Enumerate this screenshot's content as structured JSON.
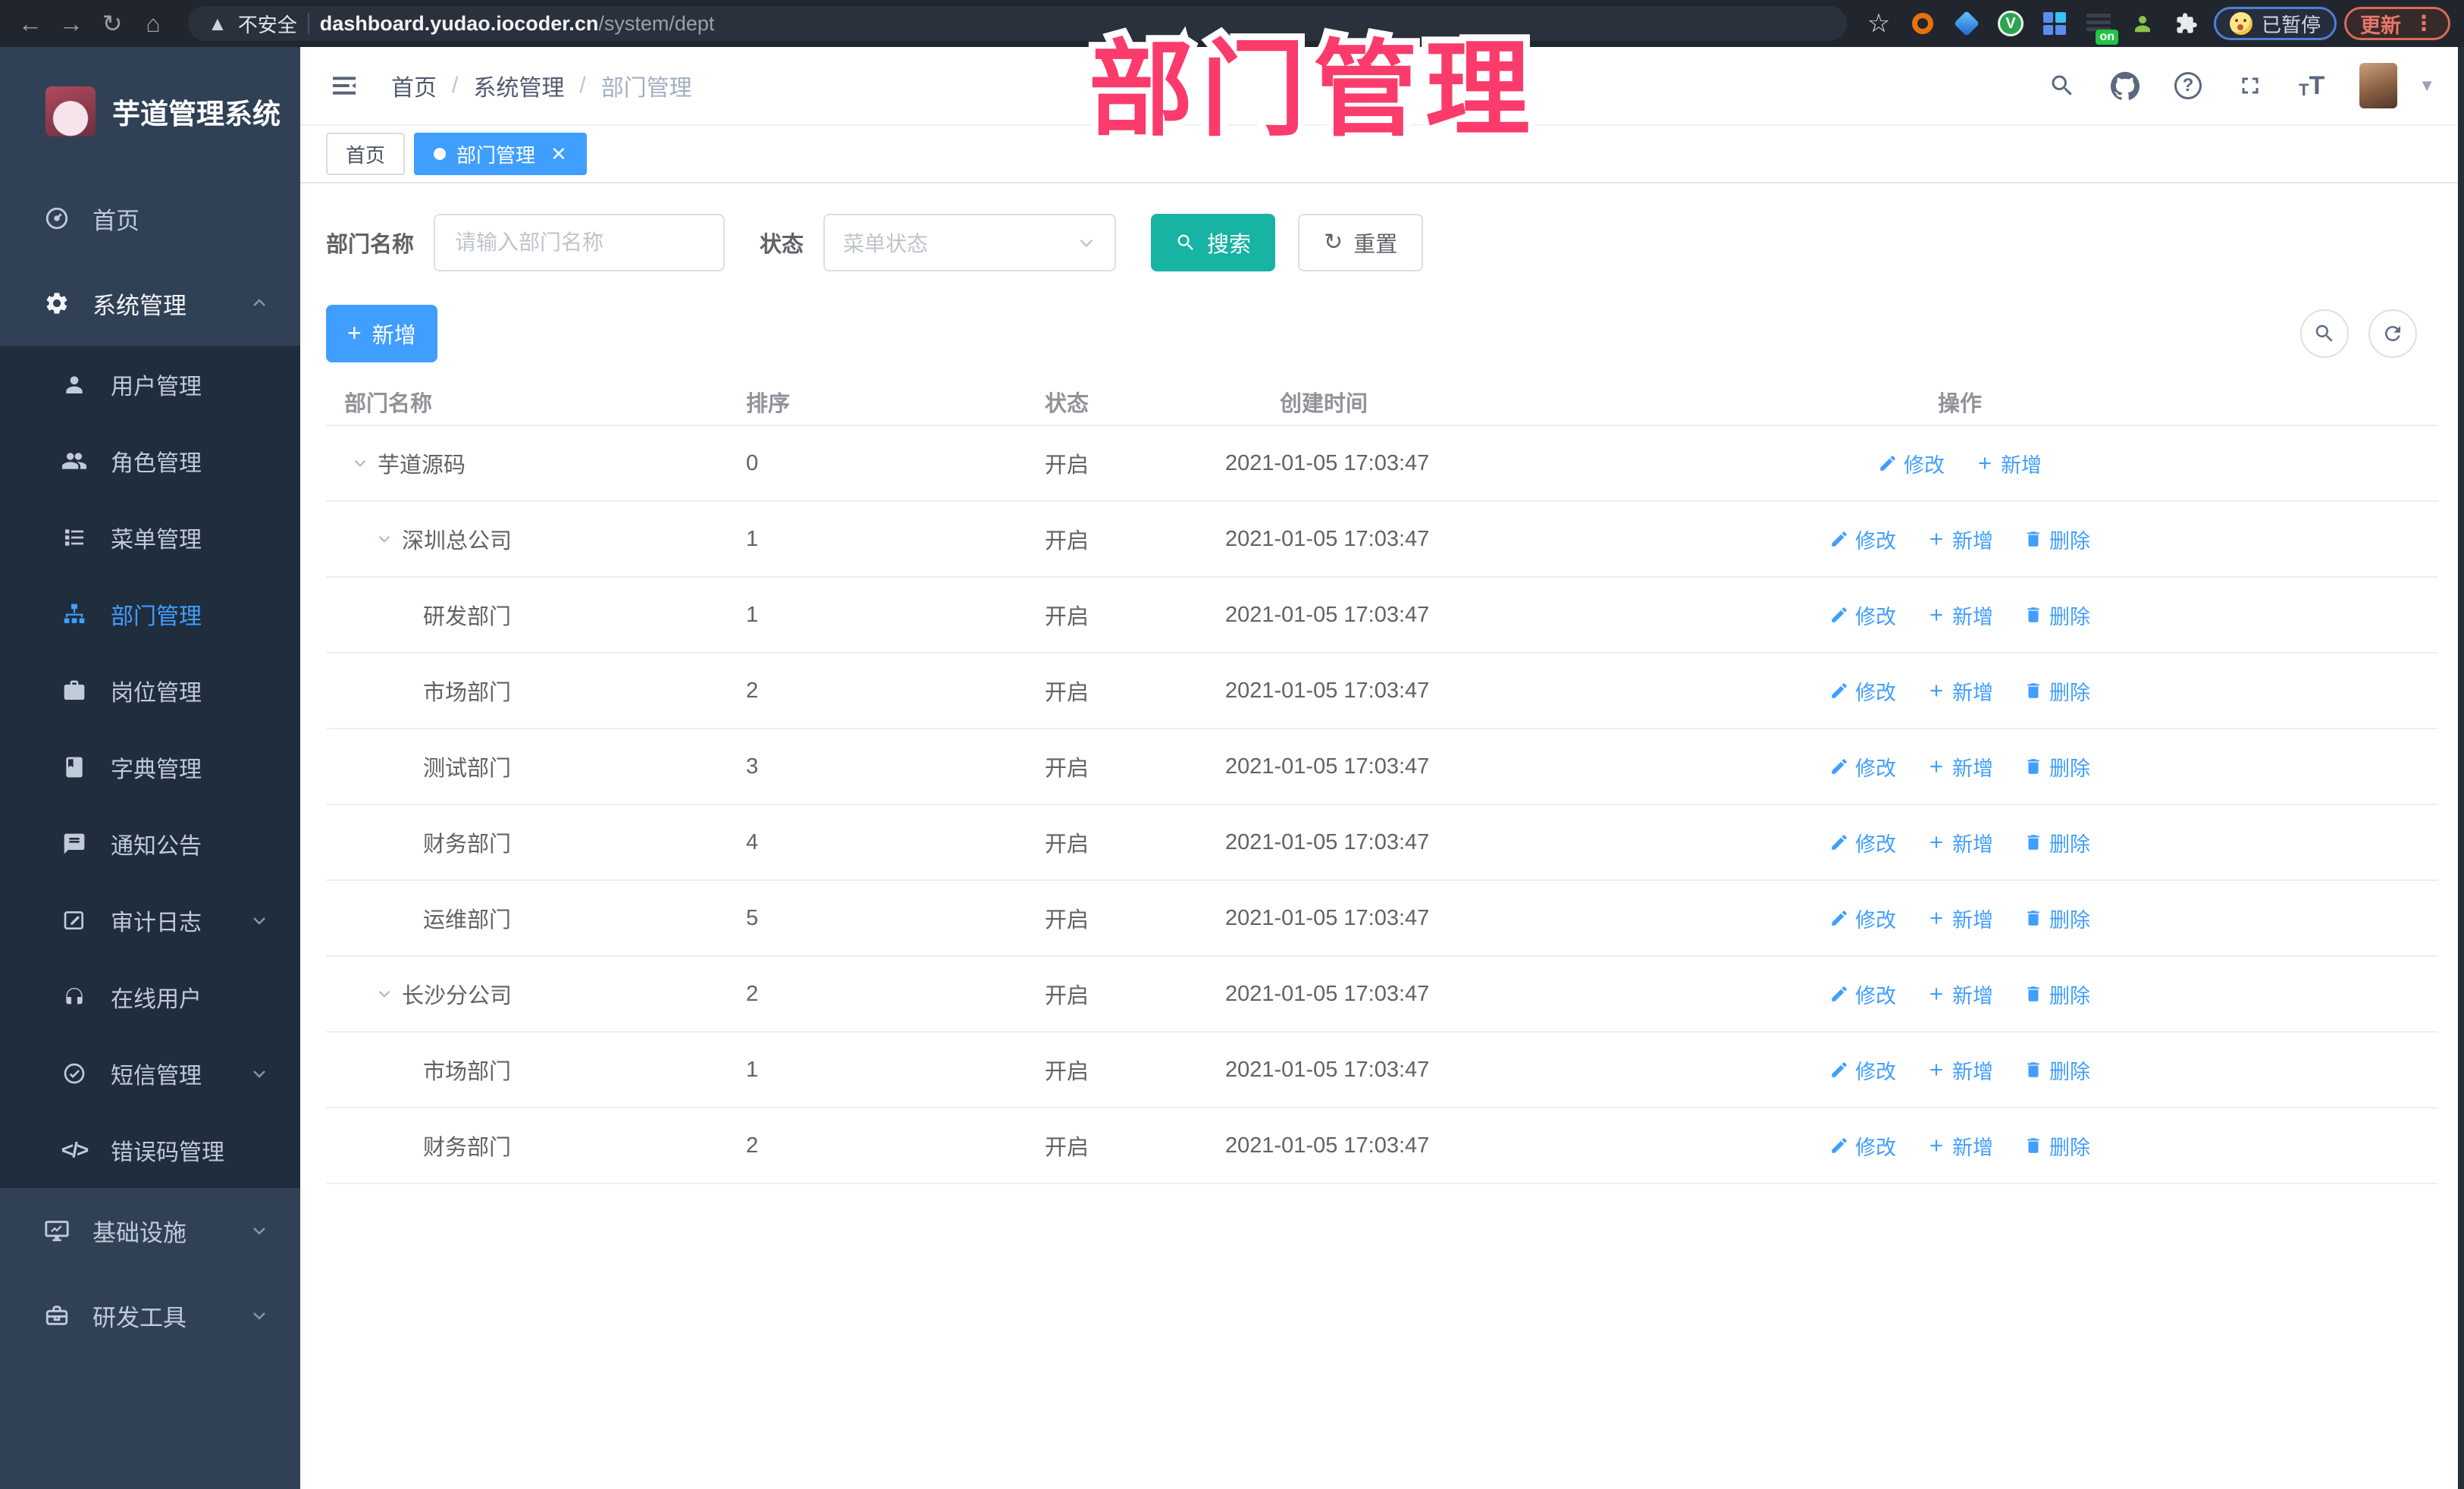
{
  "colors": {
    "accent_blue": "#409eff",
    "search_teal": "#17b3a3",
    "overlay_pink": "#fb3b6b",
    "sidebar_bg": "#304156",
    "submenu_bg": "#1f2d3d"
  },
  "browser": {
    "security_label": "不安全",
    "url_host": "dashboard.yudao.iocoder.cn",
    "url_path": "/system/dept",
    "on_badge": "on",
    "paused_label": "已暂停",
    "update_label": "更新"
  },
  "overlay": {
    "title": "部门管理"
  },
  "sidebar": {
    "title": "芋道管理系统",
    "items": [
      {
        "label": "首页"
      },
      {
        "label": "系统管理"
      }
    ],
    "submenu": [
      {
        "label": "用户管理"
      },
      {
        "label": "角色管理"
      },
      {
        "label": "菜单管理"
      },
      {
        "label": "部门管理"
      },
      {
        "label": "岗位管理"
      },
      {
        "label": "字典管理"
      },
      {
        "label": "通知公告"
      },
      {
        "label": "审计日志"
      },
      {
        "label": "在线用户"
      },
      {
        "label": "短信管理"
      },
      {
        "label": "错误码管理"
      }
    ],
    "bottom": [
      {
        "label": "基础设施"
      },
      {
        "label": "研发工具"
      }
    ],
    "code_glyph": "</>"
  },
  "header": {
    "breadcrumb": [
      "首页",
      "系统管理",
      "部门管理"
    ],
    "help_glyph": "?"
  },
  "tabs": [
    {
      "label": "首页"
    },
    {
      "label": "部门管理"
    }
  ],
  "search": {
    "name_label": "部门名称",
    "name_placeholder": "请输入部门名称",
    "status_label": "状态",
    "status_placeholder": "菜单状态",
    "search_label": "搜索",
    "reset_label": "重置"
  },
  "toolbar": {
    "add_label": "新增"
  },
  "table": {
    "columns": [
      "部门名称",
      "排序",
      "状态",
      "创建时间",
      "操作"
    ],
    "action_labels": {
      "edit": "修改",
      "add": "新增",
      "del": "删除"
    },
    "rows": [
      {
        "name": "芋道源码",
        "order": "0",
        "status": "开启",
        "created": "2021-01-05 17:03:47"
      },
      {
        "name": "深圳总公司",
        "order": "1",
        "status": "开启",
        "created": "2021-01-05 17:03:47"
      },
      {
        "name": "研发部门",
        "order": "1",
        "status": "开启",
        "created": "2021-01-05 17:03:47"
      },
      {
        "name": "市场部门",
        "order": "2",
        "status": "开启",
        "created": "2021-01-05 17:03:47"
      },
      {
        "name": "测试部门",
        "order": "3",
        "status": "开启",
        "created": "2021-01-05 17:03:47"
      },
      {
        "name": "财务部门",
        "order": "4",
        "status": "开启",
        "created": "2021-01-05 17:03:47"
      },
      {
        "name": "运维部门",
        "order": "5",
        "status": "开启",
        "created": "2021-01-05 17:03:47"
      },
      {
        "name": "长沙分公司",
        "order": "2",
        "status": "开启",
        "created": "2021-01-05 17:03:47"
      },
      {
        "name": "市场部门",
        "order": "1",
        "status": "开启",
        "created": "2021-01-05 17:03:47"
      },
      {
        "name": "财务部门",
        "order": "2",
        "status": "开启",
        "created": "2021-01-05 17:03:47"
      }
    ]
  }
}
